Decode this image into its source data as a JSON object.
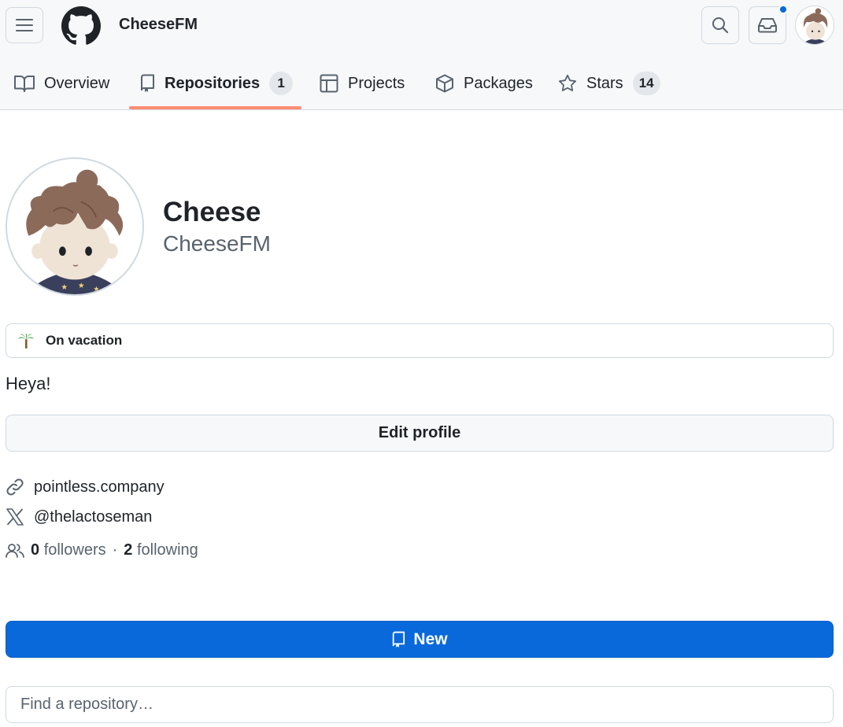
{
  "header": {
    "owner_name": "CheeseFM",
    "icons": {
      "menu": "hamburger-icon",
      "logo": "github-logo",
      "search": "search-icon",
      "inbox": "inbox-icon"
    }
  },
  "tabs": [
    {
      "label": "Overview",
      "icon": "book-icon",
      "selected": false
    },
    {
      "label": "Repositories",
      "icon": "repo-icon",
      "counter": "1",
      "selected": true
    },
    {
      "label": "Projects",
      "icon": "table-icon",
      "selected": false
    },
    {
      "label": "Packages",
      "icon": "package-icon",
      "selected": false
    },
    {
      "label": "Stars",
      "icon": "star-icon",
      "counter": "14",
      "selected": false
    }
  ],
  "profile": {
    "display_name": "Cheese",
    "username": "CheeseFM",
    "status": {
      "emoji": "palm-tree-icon",
      "text": "On vacation"
    },
    "bio": "Heya!",
    "edit_label": "Edit profile",
    "website": "pointless.company",
    "twitter": "@thelactoseman",
    "followers_count": "0",
    "followers_label": "followers",
    "separator": "·",
    "following_count": "2",
    "following_label": "following"
  },
  "repos": {
    "new_label": "New",
    "find_placeholder": "Find a repository…"
  },
  "colors": {
    "accent": "#0969da",
    "tab_underline": "#fd8c73",
    "header_bg": "#f6f8fa",
    "border": "#d1d9e0"
  }
}
